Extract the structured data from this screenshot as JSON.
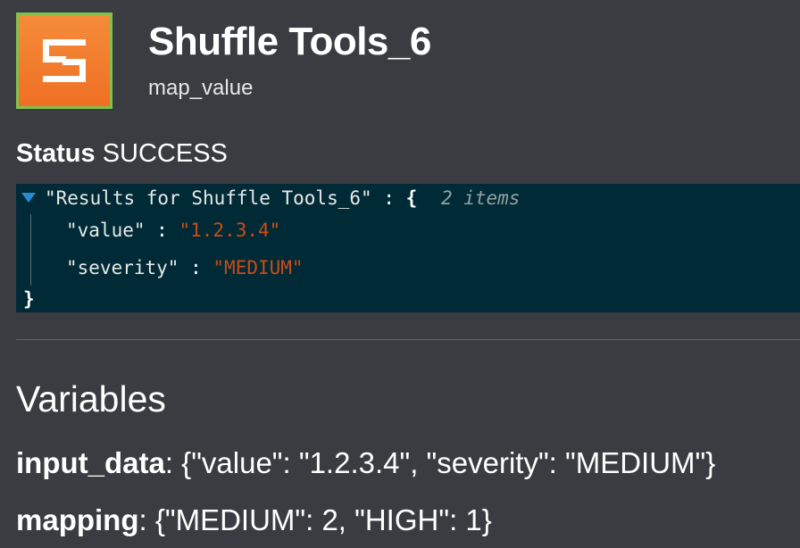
{
  "header": {
    "app_name": "Shuffle Tools_6",
    "action": "map_value",
    "icon": "shuffle-logo-icon",
    "icon_bg": "#ef6f24",
    "icon_border": "#7fc14b"
  },
  "status": {
    "label": "Status",
    "value": "SUCCESS"
  },
  "result": {
    "root_key": "\"Results for Shuffle Tools_6\"",
    "separator": ":",
    "open_brace": "{",
    "item_count": "2 items",
    "close_brace": "}",
    "entries": [
      {
        "key": "\"value\"",
        "sep": ":",
        "value": "\"1.2.3.4\""
      },
      {
        "key": "\"severity\"",
        "sep": ":",
        "value": "\"MEDIUM\""
      }
    ],
    "bg_color": "#002b36",
    "string_color": "#cb4b16",
    "arrow_color": "#268bd2"
  },
  "variables": {
    "title": "Variables",
    "items": [
      {
        "name": "input_data",
        "sep": ":",
        "value": " {\"value\": \"1.2.3.4\", \"severity\": \"MEDIUM\"}"
      },
      {
        "name": "mapping",
        "sep": ":",
        "value": " {\"MEDIUM\": 2, \"HIGH\": 1}"
      }
    ]
  }
}
